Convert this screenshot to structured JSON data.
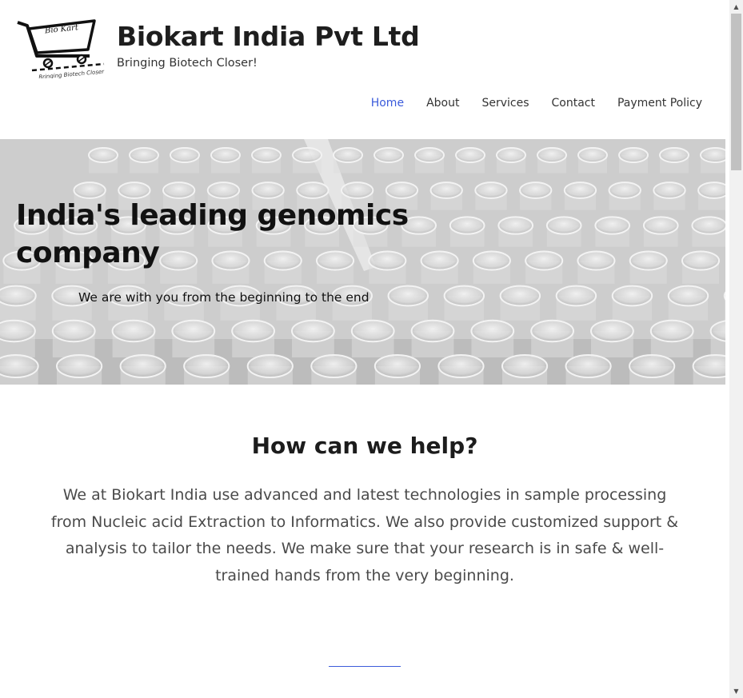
{
  "header": {
    "logo_text": "Bio Kart",
    "logo_tagline": "Bringing Biotech Closer",
    "title": "Biokart India Pvt Ltd",
    "tagline": "Bringing Biotech Closer!"
  },
  "nav": {
    "items": [
      {
        "label": "Home",
        "active": true
      },
      {
        "label": "About",
        "active": false
      },
      {
        "label": "Services",
        "active": false
      },
      {
        "label": "Contact",
        "active": false
      },
      {
        "label": "Payment Policy",
        "active": false
      }
    ]
  },
  "hero": {
    "title": "India's leading genomics company",
    "subtitle": "We are with you from the beginning to the end"
  },
  "help": {
    "title": "How can we help?",
    "text": "We at Biokart India use advanced and latest technologies in sample processing from Nucleic acid Extraction to Informatics. We also provide customized support & analysis to tailor the needs. We make sure that your research is in safe & well-trained hands from the very beginning."
  },
  "colors": {
    "accent": "#3b5bdb",
    "text": "#222222",
    "hero_bg": "#c4c4c4"
  },
  "scrollbar": {
    "up_icon": "triangle-up",
    "down_icon": "triangle-down"
  }
}
